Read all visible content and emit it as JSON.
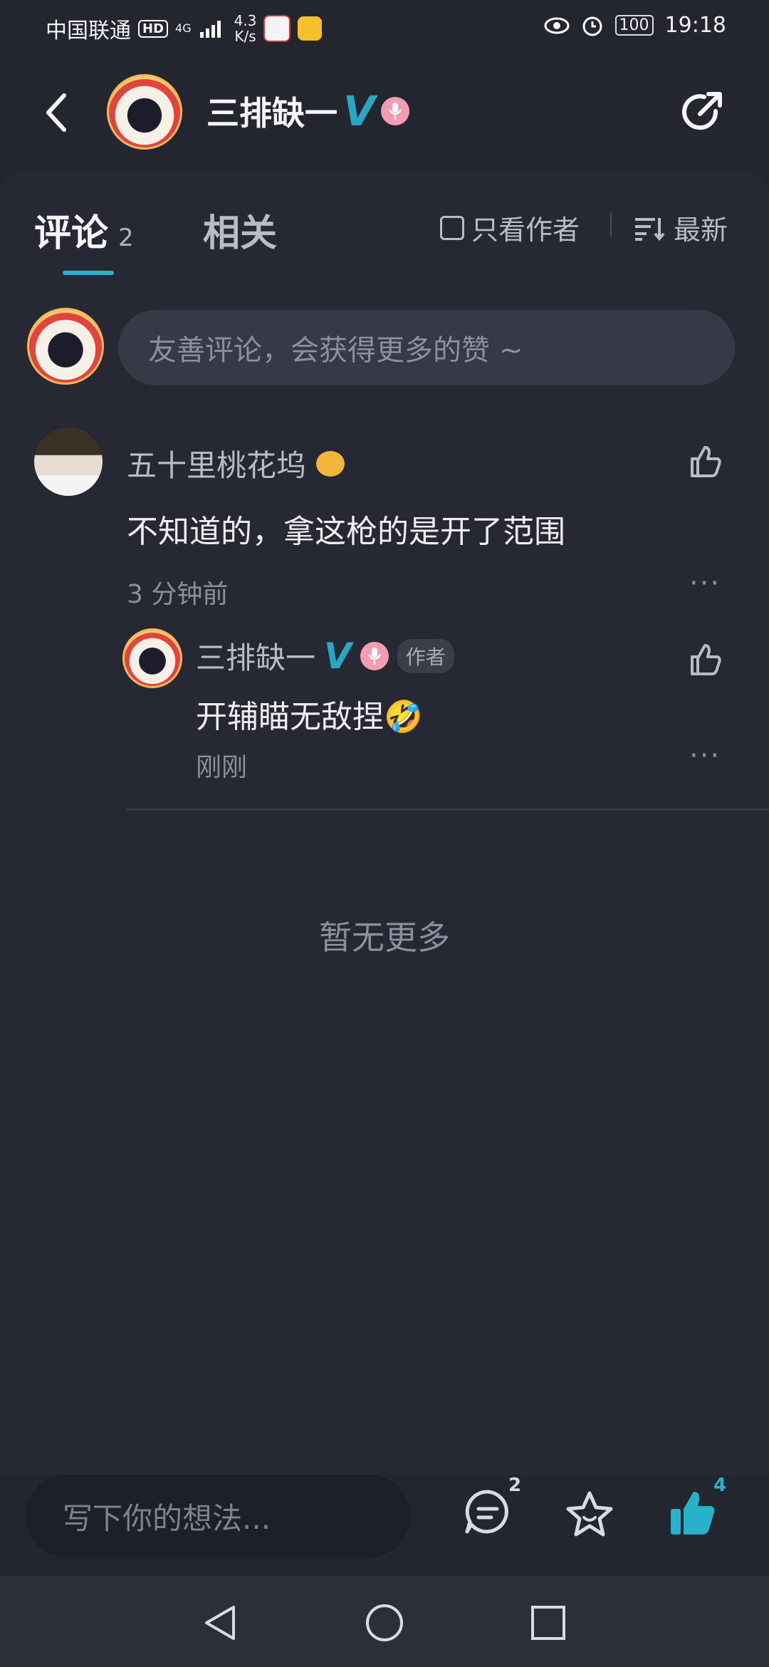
{
  "status_bar": {
    "carrier": "中国联通",
    "hd": "HD",
    "network": "4G",
    "speed_value": "4.3",
    "speed_unit": "K/s",
    "battery": "100",
    "time": "19:18"
  },
  "header": {
    "title": "三排缺一",
    "verified_mark": "V"
  },
  "tabs": {
    "comments_label": "评论",
    "comments_count": "2",
    "related_label": "相关",
    "only_author_label": "只看作者",
    "sort_label": "最新"
  },
  "comment_input": {
    "placeholder": "友善评论，会获得更多的赞 ~"
  },
  "comments": [
    {
      "user": "五十里桃花坞",
      "text": "不知道的，拿这枪的是开了范围",
      "time": "3 分钟前",
      "more": "···",
      "replies": [
        {
          "user": "三排缺一",
          "verified_mark": "V",
          "author_tag": "作者",
          "text": "开辅瞄无敌捏",
          "emoji": "🤣",
          "time": "刚刚",
          "more": "···"
        }
      ]
    }
  ],
  "footer_note": "暂无更多",
  "bottom_bar": {
    "write_placeholder": "写下你的想法...",
    "comment_count": "2",
    "like_count": "4"
  },
  "colors": {
    "background": "#23252f",
    "accent": "#27b2c9",
    "text_primary": "#eceef2",
    "text_secondary": "#8d909c"
  }
}
